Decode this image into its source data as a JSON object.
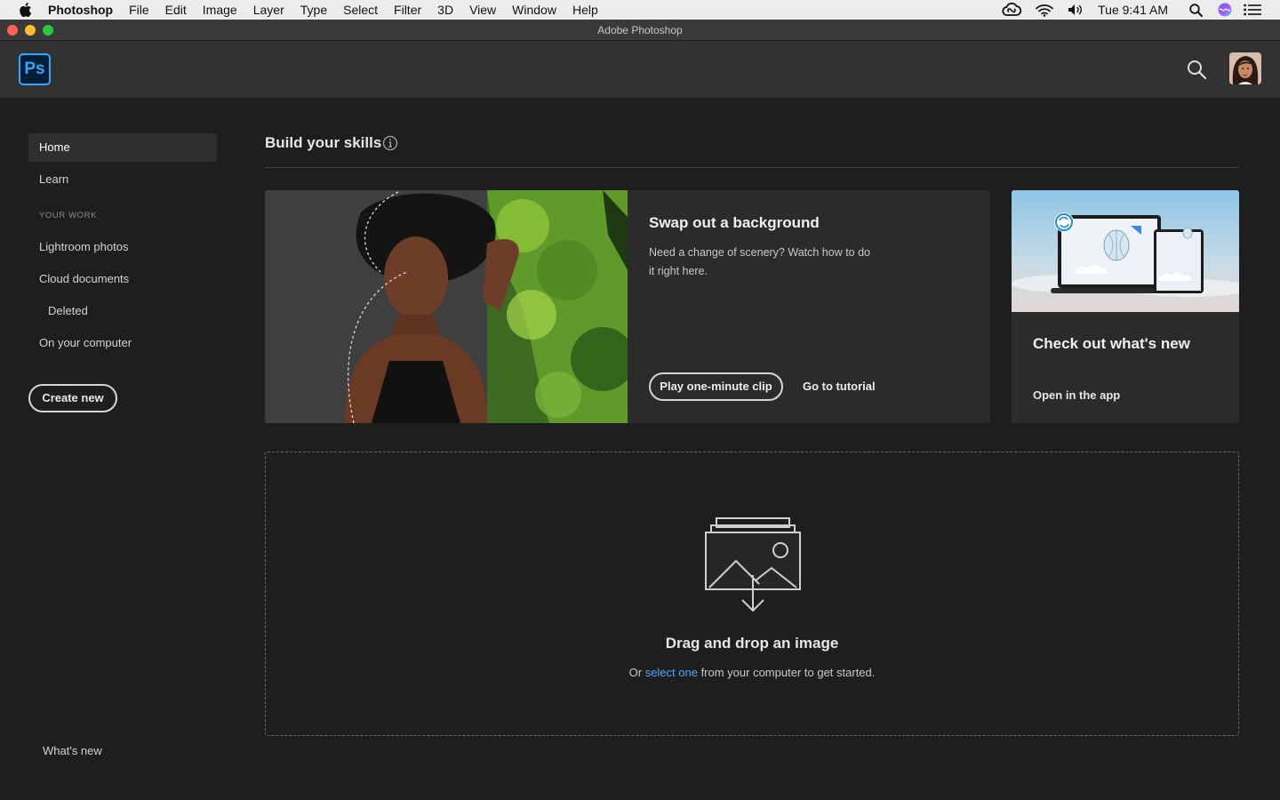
{
  "menubar": {
    "app_name": "Photoshop",
    "items": [
      "File",
      "Edit",
      "Image",
      "Layer",
      "Type",
      "Select",
      "Filter",
      "3D",
      "View",
      "Window",
      "Help"
    ],
    "clock": "Tue 9:41 AM",
    "status_icons": [
      "creative-cloud-icon",
      "wifi-icon",
      "volume-icon",
      "spotlight-search-icon",
      "siri-icon",
      "notification-center-icon"
    ]
  },
  "window": {
    "title": "Adobe Photoshop"
  },
  "header": {
    "logo": "Ps"
  },
  "sidebar": {
    "home": "Home",
    "learn": "Learn",
    "section_label": "YOUR WORK",
    "lightroom": "Lightroom photos",
    "cloud_docs": "Cloud documents",
    "deleted": "Deleted",
    "on_computer": "On your computer",
    "create_new": "Create new",
    "whats_new": "What's new"
  },
  "main": {
    "section_title": "Build your skills",
    "card_main": {
      "title": "Swap out a background",
      "desc": "Need a change of scenery? Watch how to do it right here.",
      "play_button": "Play one-minute clip",
      "tutorial_link": "Go to tutorial"
    },
    "card_side": {
      "title": "Check out what's new",
      "link": "Open in the app"
    },
    "dropzone": {
      "title": "Drag and drop an image",
      "sub_prefix": "Or ",
      "sub_link": "select one",
      "sub_suffix": " from your computer to get started."
    }
  },
  "colors": {
    "accent_blue": "#31a8ff",
    "link_blue": "#4fa2ff",
    "background": "#1e1e1e",
    "header": "#323232",
    "card": "#2b2b2b"
  }
}
